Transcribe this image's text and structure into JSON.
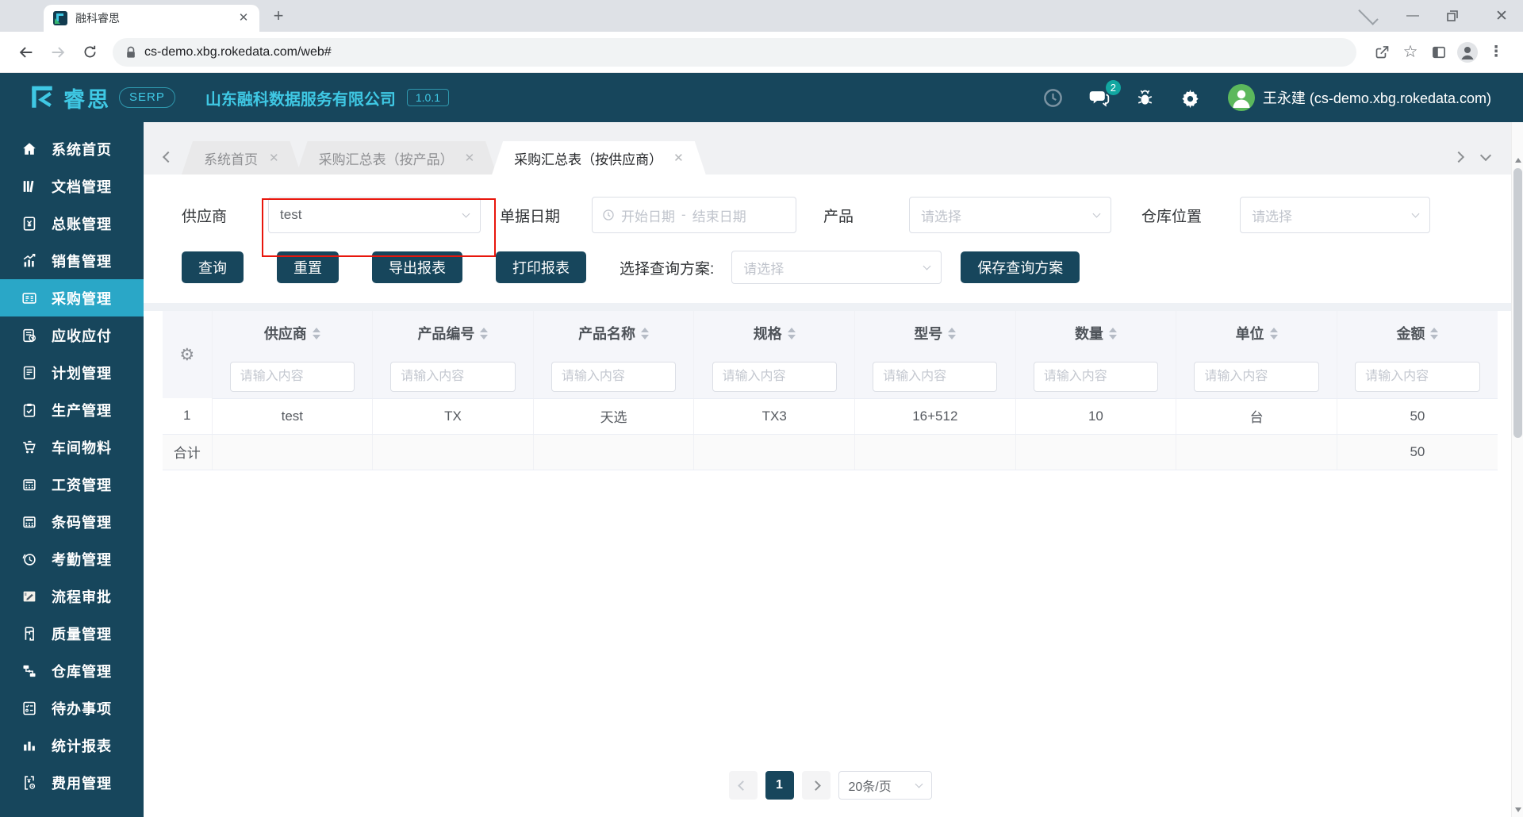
{
  "browser": {
    "tab_title": "融科睿思",
    "url": "cs-demo.xbg.rokedata.com/web#"
  },
  "app_header": {
    "logo_text": "睿思",
    "logo_badge": "SERP",
    "company": "山东融科数据服务有限公司",
    "version": "1.0.1",
    "message_badge": "2",
    "user_name": "王永建 (cs-demo.xbg.rokedata.com)"
  },
  "sidebar": {
    "items": [
      {
        "label": "系统首页"
      },
      {
        "label": "文档管理"
      },
      {
        "label": "总账管理"
      },
      {
        "label": "销售管理"
      },
      {
        "label": "采购管理",
        "active": true
      },
      {
        "label": "应收应付"
      },
      {
        "label": "计划管理"
      },
      {
        "label": "生产管理"
      },
      {
        "label": "车间物料"
      },
      {
        "label": "工资管理"
      },
      {
        "label": "条码管理"
      },
      {
        "label": "考勤管理"
      },
      {
        "label": "流程审批"
      },
      {
        "label": "质量管理"
      },
      {
        "label": "仓库管理"
      },
      {
        "label": "待办事项"
      },
      {
        "label": "统计报表"
      },
      {
        "label": "费用管理"
      }
    ]
  },
  "workspace_tabs": [
    {
      "label": "系统首页"
    },
    {
      "label": "采购汇总表（按产品）"
    },
    {
      "label": "采购汇总表（按供应商）",
      "active": true
    }
  ],
  "filters": {
    "supplier_label": "供应商",
    "supplier_value": "test",
    "date_label": "单据日期",
    "date_start_placeholder": "开始日期",
    "date_separator": "-",
    "date_end_placeholder": "结束日期",
    "product_label": "产品",
    "product_placeholder": "请选择",
    "warehouse_label": "仓库位置",
    "warehouse_placeholder": "请选择"
  },
  "actions": {
    "query": "查询",
    "reset": "重置",
    "export_report": "导出报表",
    "print_report": "打印报表",
    "plan_select_label": "选择查询方案:",
    "plan_placeholder": "请选择",
    "save_plan": "保存查询方案"
  },
  "table": {
    "columns": [
      "供应商",
      "产品编号",
      "产品名称",
      "规格",
      "型号",
      "数量",
      "单位",
      "金额"
    ],
    "filter_placeholder": "请输入内容",
    "rows": [
      {
        "index": "1",
        "cells": [
          "test",
          "TX",
          "天选",
          "TX3",
          "16+512",
          "10",
          "台",
          "50"
        ]
      }
    ],
    "total_row": {
      "index": "合计",
      "cells": [
        "",
        "",
        "",
        "",
        "",
        "",
        "",
        "50"
      ]
    }
  },
  "pagination": {
    "page": "1",
    "page_size": "20条/页"
  },
  "colors": {
    "header_navy": "#17465c",
    "sidebar_active_cyan": "#2aa7c7",
    "brand_cyan": "#3fc8e4",
    "message_badge_teal": "#12a7a1",
    "avatar_green": "#5cb85c",
    "annotation_red": "#e8160c"
  }
}
